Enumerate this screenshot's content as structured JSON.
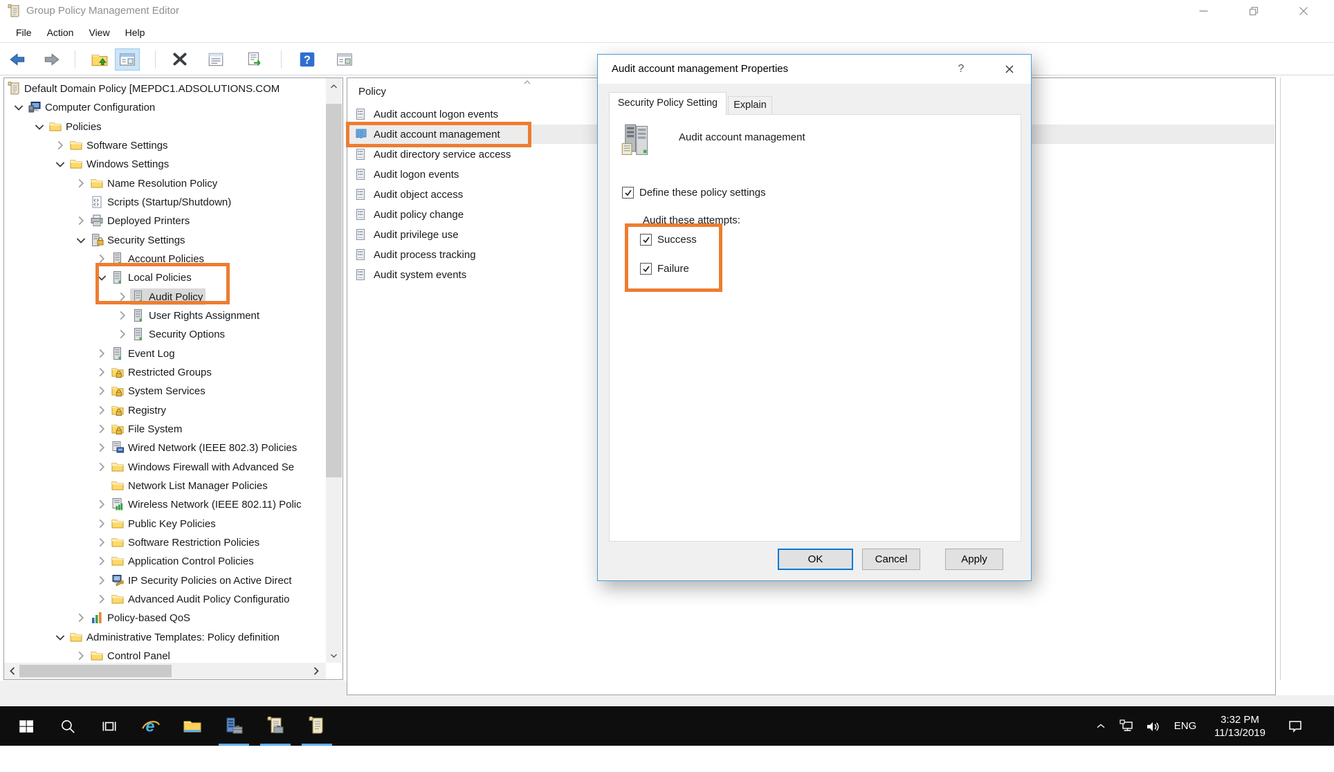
{
  "window": {
    "title": "Group Policy Management Editor"
  },
  "menu": {
    "items": [
      "File",
      "Action",
      "View",
      "Help"
    ]
  },
  "toolbar": {
    "items": [
      {
        "icon": "back-arrow"
      },
      {
        "icon": "forward-arrow"
      },
      {
        "sep": true
      },
      {
        "icon": "show-console-tree"
      },
      {
        "icon": "console-window",
        "highlighted": true
      },
      {
        "sep": true
      },
      {
        "icon": "delete-x"
      },
      {
        "icon": "properties"
      },
      {
        "icon": "export-list"
      },
      {
        "sep": true
      },
      {
        "icon": "help"
      },
      {
        "icon": "console-window-alt"
      }
    ]
  },
  "tree": {
    "items": [
      {
        "label": "Default Domain Policy [MEPDC1.ADSOLUTIONS.COM",
        "level": 0,
        "chev": "none",
        "icon": "gpo-scroll"
      },
      {
        "label": "Computer Configuration",
        "level": 1,
        "chev": "expanded",
        "icon": "computer"
      },
      {
        "label": "Policies",
        "level": 2,
        "chev": "expanded",
        "icon": "folder"
      },
      {
        "label": "Software Settings",
        "level": 3,
        "chev": "collapsed",
        "icon": "folder"
      },
      {
        "label": "Windows Settings",
        "level": 3,
        "chev": "expanded",
        "icon": "folder"
      },
      {
        "label": "Name Resolution Policy",
        "level": 4,
        "chev": "collapsed",
        "icon": "folder"
      },
      {
        "label": "Scripts (Startup/Shutdown)",
        "level": 4,
        "chev": "none",
        "icon": "script"
      },
      {
        "label": "Deployed Printers",
        "level": 4,
        "chev": "collapsed",
        "icon": "printer"
      },
      {
        "label": "Security Settings",
        "level": 4,
        "chev": "expanded",
        "icon": "server-lock"
      },
      {
        "label": "Account Policies",
        "level": 5,
        "chev": "collapsed",
        "icon": "server"
      },
      {
        "label": "Local Policies",
        "level": 5,
        "chev": "expanded",
        "icon": "server"
      },
      {
        "label": "Audit Policy",
        "level": 6,
        "chev": "collapsed",
        "icon": "server",
        "selected": true
      },
      {
        "label": "User Rights Assignment",
        "level": 6,
        "chev": "collapsed",
        "icon": "server"
      },
      {
        "label": "Security Options",
        "level": 6,
        "chev": "collapsed",
        "icon": "server"
      },
      {
        "label": "Event Log",
        "level": 5,
        "chev": "collapsed",
        "icon": "server"
      },
      {
        "label": "Restricted Groups",
        "level": 5,
        "chev": "collapsed",
        "icon": "folder-lock"
      },
      {
        "label": "System Services",
        "level": 5,
        "chev": "collapsed",
        "icon": "folder-lock"
      },
      {
        "label": "Registry",
        "level": 5,
        "chev": "collapsed",
        "icon": "folder-lock"
      },
      {
        "label": "File System",
        "level": 5,
        "chev": "collapsed",
        "icon": "folder-lock"
      },
      {
        "label": "Wired Network (IEEE 802.3) Policies",
        "level": 5,
        "chev": "collapsed",
        "icon": "wired-network"
      },
      {
        "label": "Windows Firewall with Advanced Se",
        "level": 5,
        "chev": "collapsed",
        "icon": "folder"
      },
      {
        "label": "Network List Manager Policies",
        "level": 5,
        "chev": "none",
        "icon": "folder"
      },
      {
        "label": "Wireless Network (IEEE 802.11) Polic",
        "level": 5,
        "chev": "collapsed",
        "icon": "wireless-network"
      },
      {
        "label": "Public Key Policies",
        "level": 5,
        "chev": "collapsed",
        "icon": "folder"
      },
      {
        "label": "Software Restriction Policies",
        "level": 5,
        "chev": "collapsed",
        "icon": "folder"
      },
      {
        "label": "Application Control Policies",
        "level": 5,
        "chev": "collapsed",
        "icon": "folder"
      },
      {
        "label": "IP Security Policies on Active Direct",
        "level": 5,
        "chev": "collapsed",
        "icon": "ip-security"
      },
      {
        "label": "Advanced Audit Policy Configuratio",
        "level": 5,
        "chev": "collapsed",
        "icon": "folder"
      },
      {
        "label": "Policy-based QoS",
        "level": 4,
        "chev": "collapsed",
        "icon": "qos"
      },
      {
        "label": "Administrative Templates: Policy definition",
        "level": 3,
        "chev": "expanded",
        "icon": "folder"
      },
      {
        "label": "Control Panel",
        "level": 4,
        "chev": "collapsed",
        "icon": "folder"
      }
    ]
  },
  "policy_list": {
    "header": "Policy",
    "items": [
      {
        "label": "Audit account logon events"
      },
      {
        "label": "Audit account management",
        "selected": true
      },
      {
        "label": "Audit directory service access"
      },
      {
        "label": "Audit logon events"
      },
      {
        "label": "Audit object access"
      },
      {
        "label": "Audit policy change"
      },
      {
        "label": "Audit privilege use"
      },
      {
        "label": "Audit process tracking"
      },
      {
        "label": "Audit system events"
      }
    ]
  },
  "dialog": {
    "title": "Audit account management Properties",
    "help_label": "?",
    "tabs": [
      {
        "label": "Security Policy Setting",
        "active": true
      },
      {
        "label": "Explain",
        "active": false
      }
    ],
    "policy_name": "Audit account management",
    "define_checkbox": {
      "label": "Define these policy settings",
      "checked": true
    },
    "attempts_label": "Audit these attempts:",
    "options": [
      {
        "label": "Success",
        "checked": true
      },
      {
        "label": "Failure",
        "checked": true
      }
    ],
    "buttons": {
      "ok": "OK",
      "cancel": "Cancel",
      "apply": "Apply"
    }
  },
  "taskbar": {
    "apps": [
      {
        "name": "start"
      },
      {
        "name": "search"
      },
      {
        "name": "task-view"
      },
      {
        "name": "internet-explorer"
      },
      {
        "name": "file-explorer"
      },
      {
        "name": "server-manager",
        "open": true
      },
      {
        "name": "gpmc",
        "open": true
      },
      {
        "name": "gp-editor",
        "open": true
      }
    ],
    "tray": {
      "lang": "ENG",
      "time": "3:32 PM",
      "date": "11/13/2019"
    }
  },
  "annotations": {
    "color": "#ed7d31",
    "boxes": [
      {
        "target": "tree-local-policies-audit-policy"
      },
      {
        "target": "list-audit-account-management"
      },
      {
        "target": "dialog-success-failure-checkboxes"
      }
    ]
  }
}
